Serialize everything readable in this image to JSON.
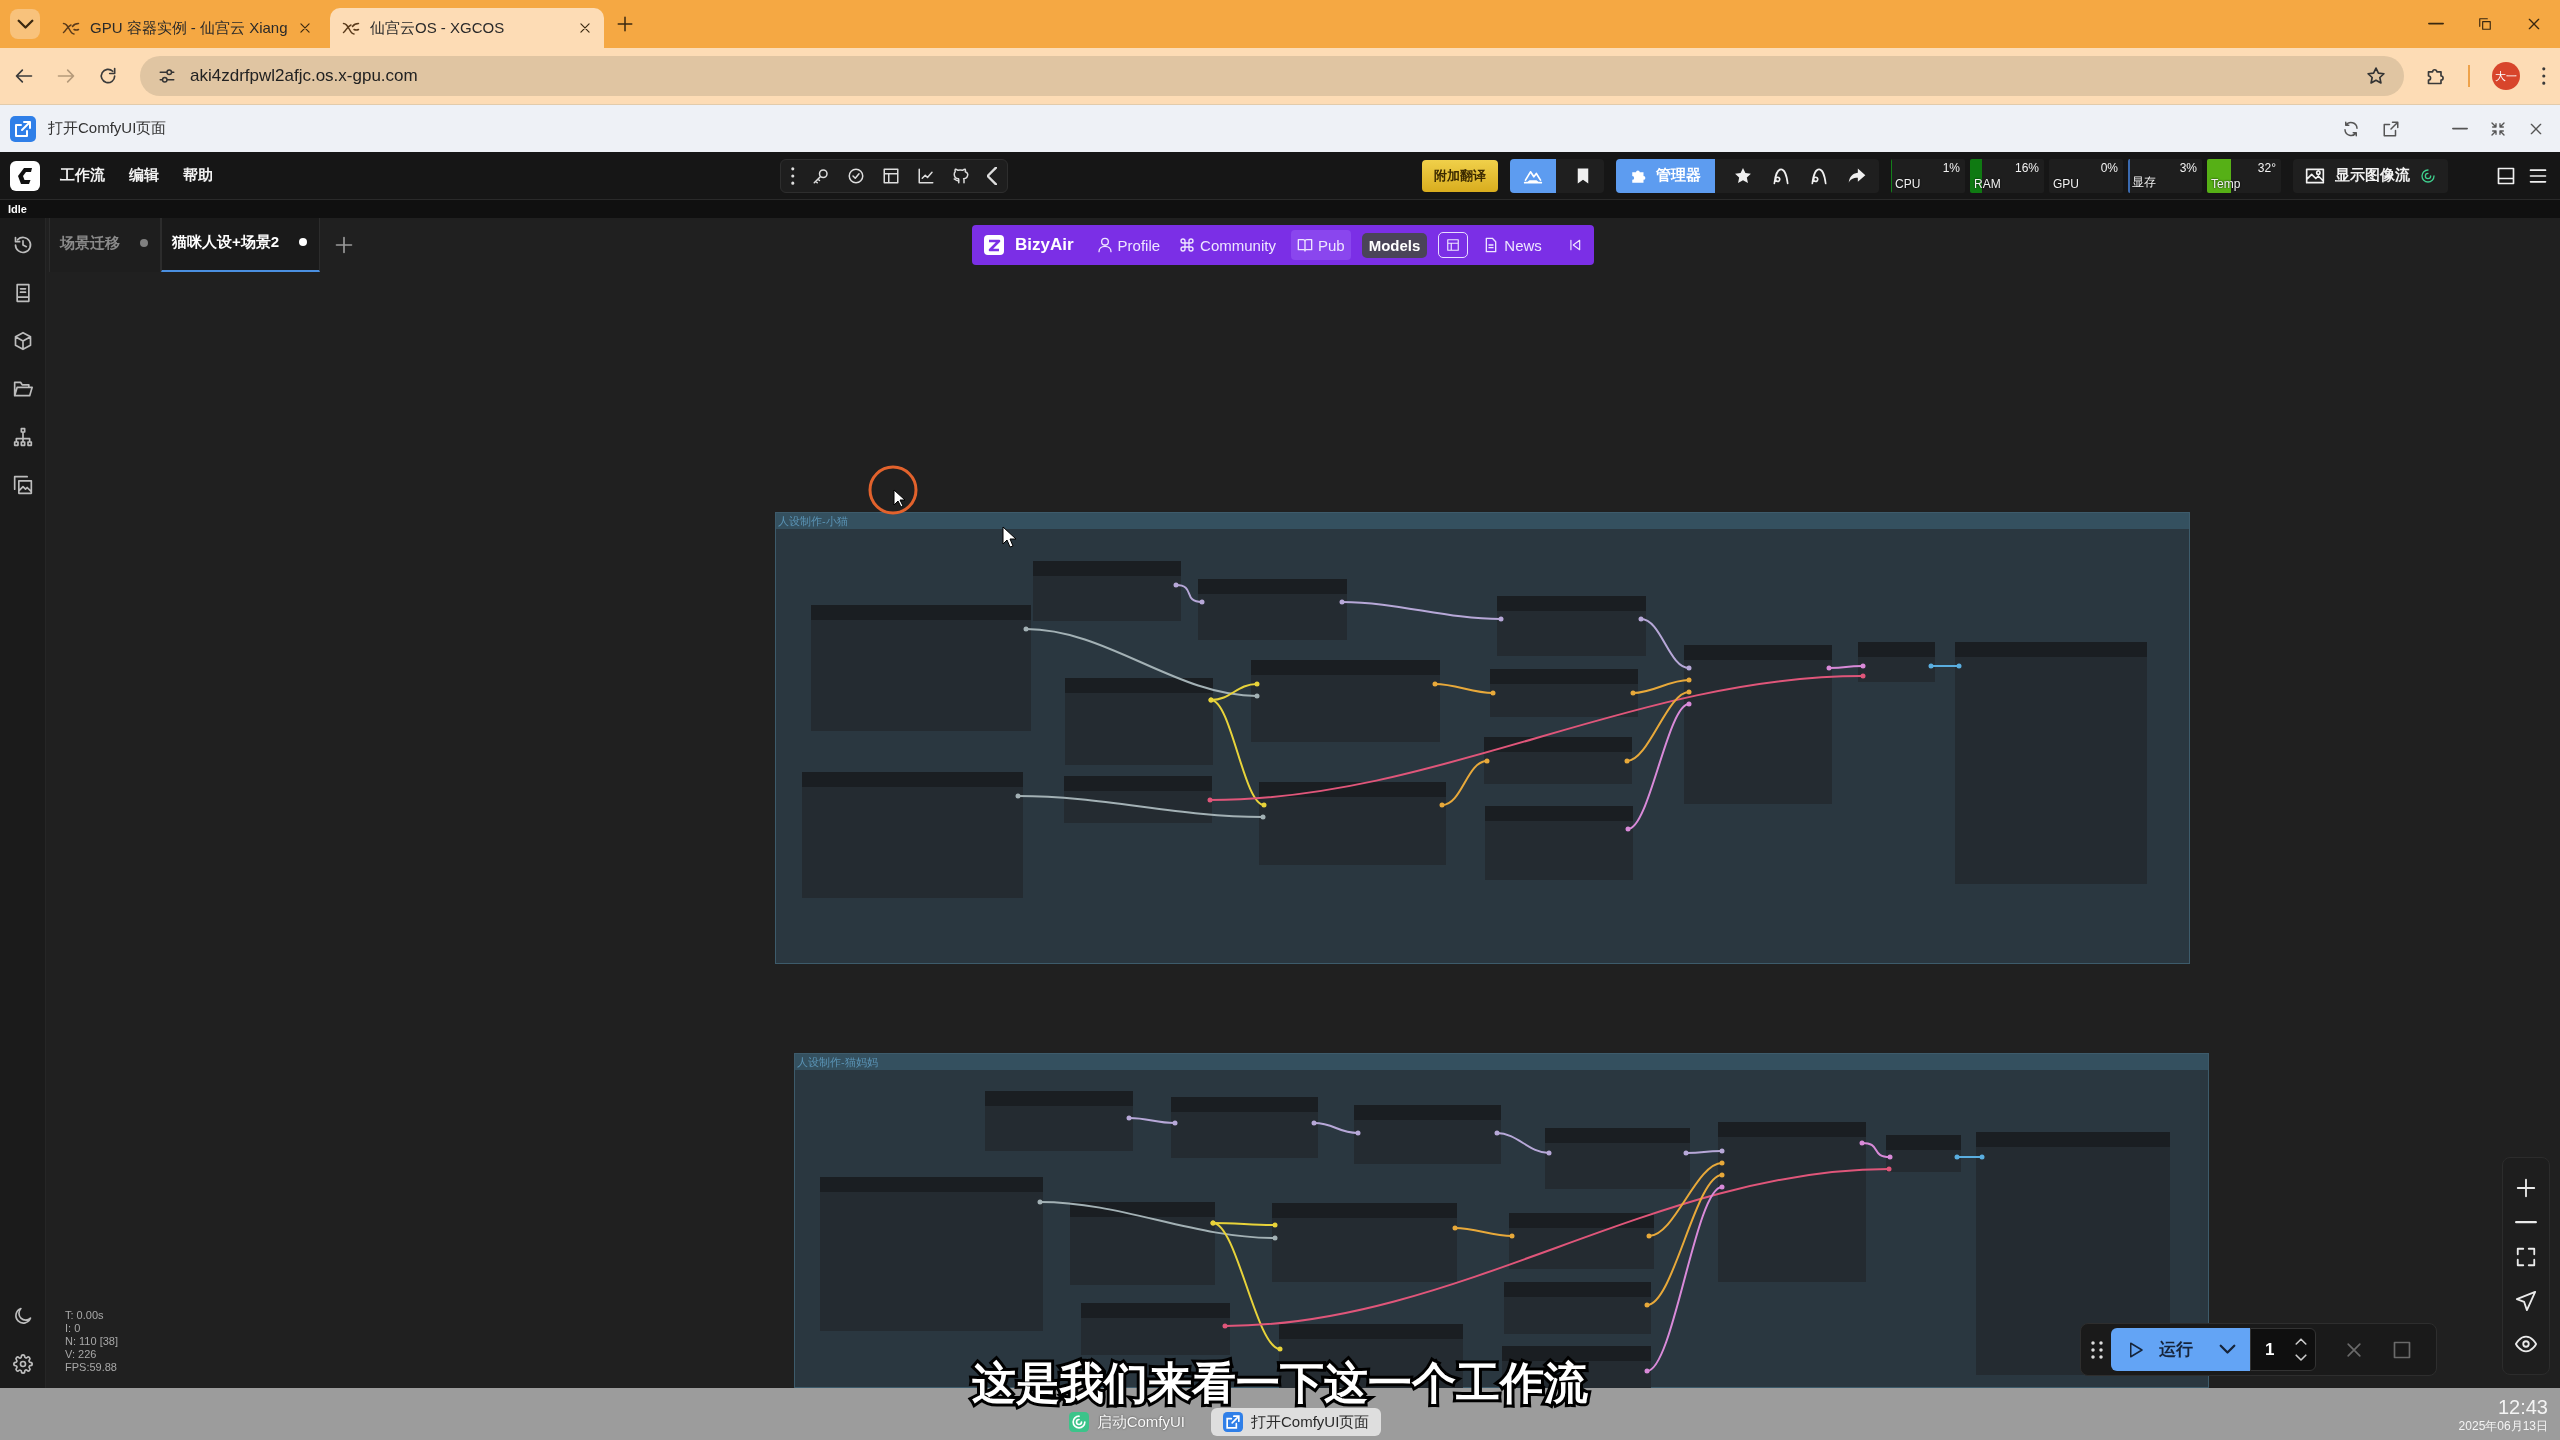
{
  "browser": {
    "tabs": [
      {
        "title": "GPU 容器实例 - 仙宫云 Xiang",
        "selected": false
      },
      {
        "title": "仙宫云OS - XGCOS",
        "selected": true
      }
    ],
    "forward_disabled": true,
    "url": "aki4zdrfpwl2afjc.os.x-gpu.com",
    "profile": "大一"
  },
  "app_window": {
    "title": "打开ComfyUI页面"
  },
  "menu_bar": {
    "items": [
      "工作流",
      "编辑",
      "帮助"
    ],
    "status": "Idle"
  },
  "toolbar": {
    "translate_button": "附加翻译",
    "manager_button": "管理器",
    "monitors": [
      {
        "label": "CPU",
        "reading": "1%",
        "level": 0.01,
        "color": "#14801a"
      },
      {
        "label": "RAM",
        "reading": "16%",
        "level": 0.16,
        "color": "#0f7a12"
      },
      {
        "label": "GPU",
        "reading": "0%"
      },
      {
        "label": "显存",
        "reading": "3%",
        "level": 0.03,
        "color": "#3a6ab0"
      },
      {
        "label": "Temp",
        "reading": "32°",
        "level": 0.32,
        "color": "#56b016"
      }
    ],
    "image_feed_button": "显示图像流"
  },
  "workflow_tabs": [
    {
      "label": "场景迁移",
      "selected": false,
      "unsaved": true
    },
    {
      "label": "猫咪人设+场景2",
      "selected": true,
      "unsaved": true
    }
  ],
  "bizyair": {
    "title": "BizyAir",
    "items": [
      {
        "kind": "profile",
        "label": "Profile"
      },
      {
        "kind": "community",
        "label": "Community"
      },
      {
        "kind": "publish",
        "label": "Pub"
      },
      {
        "kind": "tooltip",
        "label": "Models"
      },
      {
        "kind": "models"
      },
      {
        "kind": "news",
        "label": "News"
      }
    ]
  },
  "canvas": {
    "groups": [
      {
        "title": "人设制作-小猫"
      },
      {
        "title": "人设制作-猫妈妈"
      }
    ],
    "stats": [
      "T: 0.00s",
      "I: 0",
      "N: 110 [38]",
      "V: 226",
      "FPS:59.88"
    ]
  },
  "run_bar": {
    "run_button": "运行",
    "batch_count": "1"
  },
  "subtitle": "这是我们来看一下这一个工作流",
  "taskbar": {
    "items": [
      {
        "kind": "launcher",
        "label": "启动ComfyUI",
        "selected": false
      },
      {
        "kind": "page",
        "label": "打开ComfyUI页面",
        "selected": true
      }
    ],
    "time": "12:43",
    "date": "2025年06月13日"
  }
}
